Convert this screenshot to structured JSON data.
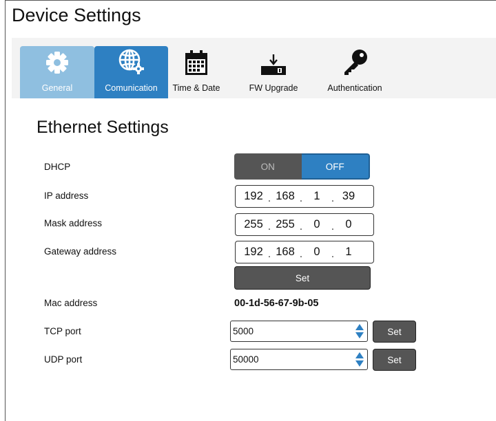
{
  "page": {
    "title": "Device Settings"
  },
  "tabs": [
    {
      "label": "General",
      "icon": "gear-icon"
    },
    {
      "label": "Comunication",
      "icon": "globe-gear-icon"
    },
    {
      "label": "Time & Date",
      "icon": "calendar-icon"
    },
    {
      "label": "FW Upgrade",
      "icon": "download-device-icon"
    },
    {
      "label": "Authentication",
      "icon": "key-icon"
    }
  ],
  "ethernet": {
    "title": "Ethernet Settings",
    "dhcp": {
      "label": "DHCP",
      "on_label": "ON",
      "off_label": "OFF",
      "selected": "OFF"
    },
    "ip": {
      "label": "IP address",
      "octets": [
        "192",
        "168",
        "1",
        "39"
      ]
    },
    "mask": {
      "label": "Mask address",
      "octets": [
        "255",
        "255",
        "0",
        "0"
      ]
    },
    "gateway": {
      "label": "Gateway address",
      "octets": [
        "192",
        "168",
        "0",
        "1"
      ]
    },
    "set_label": "Set",
    "mac": {
      "label": "Mac address",
      "value": "00-1d-56-67-9b-05"
    },
    "tcp": {
      "label": "TCP port",
      "value": "5000",
      "set_label": "Set"
    },
    "udp": {
      "label": "UDP port",
      "value": "50000",
      "set_label": "Set"
    }
  },
  "colors": {
    "accent": "#2e80c2",
    "tab_inactive_selected": "#8fbfe0",
    "button_dark": "#555555",
    "panel_bg": "#f3f3f3"
  }
}
